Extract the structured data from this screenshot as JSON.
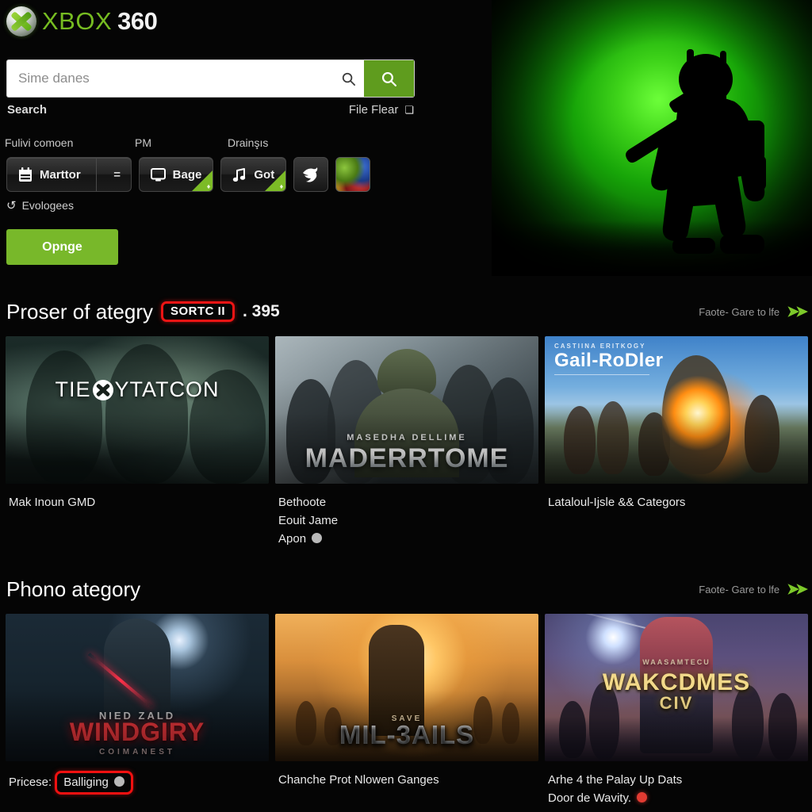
{
  "brand": {
    "xbox": "XBOX",
    "num": "360",
    "orb_icon": "xbox-orb-icon"
  },
  "search": {
    "value": "",
    "placeholder": "Sime danes",
    "inline_icon": "search-icon",
    "button_icon": "search-icon",
    "button_color": "#5f9c1e"
  },
  "meta": {
    "left_label": "Search",
    "right_label": "File Flear",
    "caret": "❯"
  },
  "filters": {
    "labels": [
      "Fulivi comoen",
      "PM",
      "Drainşıs"
    ],
    "pills": [
      {
        "label": "Marttor",
        "icon": "calendar-icon",
        "trailing": "=",
        "badge": false
      },
      {
        "label": "Bage",
        "icon": "monitor-icon",
        "badge": true
      },
      {
        "label": "Got",
        "icon": "music-note-icon",
        "badge": true
      }
    ],
    "icon_buttons": [
      {
        "name": "bird-icon-button",
        "glyph": "🐦"
      },
      {
        "name": "thumbnail-tile-button",
        "glyph": ""
      }
    ],
    "refresh": {
      "glyph": "↺",
      "label": "Evologees"
    },
    "cta": "Opnge"
  },
  "sections": [
    {
      "title": "Proser of ategry",
      "badge": "SORTC II",
      "count": ". 395",
      "more_label": "Faote- Gare to lfe",
      "more_icon": "double-chevron-right-icon",
      "cards": [
        {
          "art_kind": "art1",
          "art_main": "YTATCON",
          "art_pre": "TIE",
          "art_sub": "",
          "caption": [
            "Mak Inoun GMD"
          ],
          "dot": ""
        },
        {
          "art_kind": "art2",
          "art_sub": "MASEDHA DELLIME",
          "art_main": "MADERRTOME",
          "caption": [
            "Bethoote",
            "Eouit Jame",
            "Apon"
          ],
          "dot": "grey"
        },
        {
          "art_kind": "art3",
          "art_sub": "CASTIINA ERITKOGY",
          "art_main": "Gail-RoDler",
          "caption": [
            "Lataloul-Ijsle && Categors"
          ],
          "dot": ""
        }
      ]
    },
    {
      "title": "Phono ategory",
      "badge": "",
      "count": "",
      "more_label": "Faote- Gare to lfe",
      "more_icon": "double-chevron-right-icon",
      "cards": [
        {
          "art_kind": "art4",
          "art_sub": "NIED ZALD",
          "art_main": "WINDGIRY",
          "art_foot": "COIMANEST",
          "caption_pre": "Pricese:",
          "caption_ring": "Balliging",
          "caption": [],
          "dot": "grey"
        },
        {
          "art_kind": "art5",
          "art_sub": "SAVE",
          "art_main": "MIL-3AILS",
          "caption": [
            "Chanche Prot Nlowen Ganges"
          ],
          "dot": ""
        },
        {
          "art_kind": "art6",
          "art_sub": "WAASAMTECU",
          "art_main": "WAKCDMES",
          "art_main2": "CIV",
          "caption": [
            "Arhe 4 the Palay Up Dats",
            "Door de Wavity."
          ],
          "dot": "red"
        }
      ]
    }
  ],
  "hero": {
    "name": "soldier-silhouette-hero",
    "glow_color": "#3fd41a"
  }
}
